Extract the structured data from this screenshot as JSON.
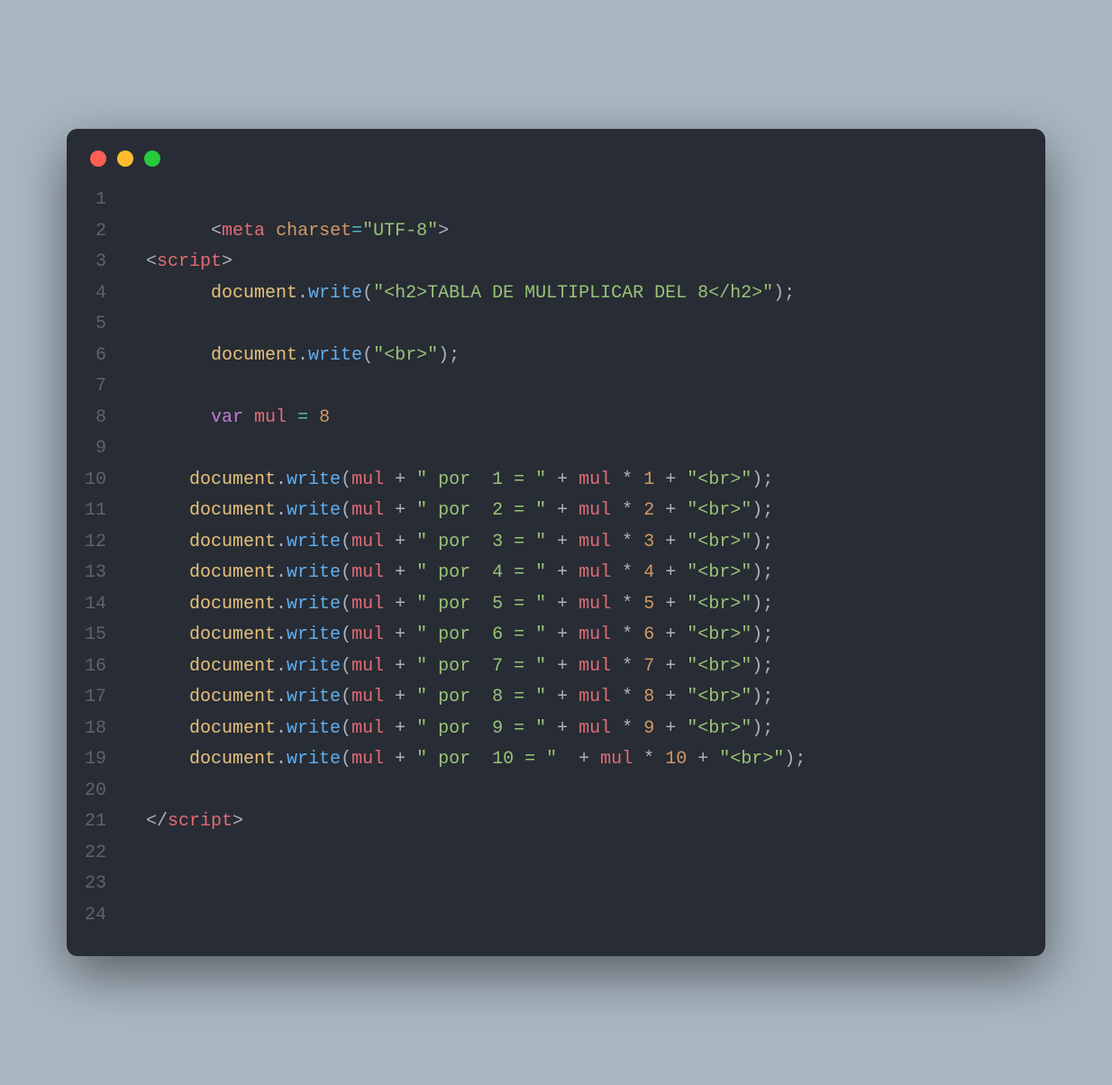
{
  "colors": {
    "background": "#abb8c3",
    "window": "#282c34",
    "red": "#ff5f56",
    "yellow": "#ffbd2e",
    "green": "#27c93f"
  },
  "lineNumbers": [
    "1",
    "2",
    "3",
    "4",
    "5",
    "6",
    "7",
    "8",
    "9",
    "10",
    "11",
    "12",
    "13",
    "14",
    "15",
    "16",
    "17",
    "18",
    "19",
    "20",
    "21",
    "22",
    "23",
    "24"
  ],
  "code": {
    "l2": {
      "indent": "        ",
      "lt": "<",
      "tag": "meta",
      "sp": " ",
      "attr": "charset",
      "eq": "=",
      "val": "\"UTF-8\"",
      "gt": ">"
    },
    "l3": {
      "indent": "  ",
      "lt": "<",
      "tag": "script",
      "gt": ">"
    },
    "l4": {
      "indent": "        ",
      "obj": "document",
      "dot": ".",
      "fn": "write",
      "lp": "(",
      "str": "\"<h2>TABLA DE MULTIPLICAR DEL 8</h2>\"",
      "rp": ")",
      "semi": ";"
    },
    "l6": {
      "indent": "        ",
      "obj": "document",
      "dot": ".",
      "fn": "write",
      "lp": "(",
      "str": "\"<br>\"",
      "rp": ")",
      "semi": ";"
    },
    "l8": {
      "indent": "        ",
      "kw": "var",
      "sp": " ",
      "name": "mul",
      "sp2": " ",
      "eq": "=",
      "sp3": " ",
      "num": "8"
    },
    "rows": [
      {
        "ln": "10",
        "str1": "\" por  1 = \"",
        "n": "1",
        "last": false
      },
      {
        "ln": "11",
        "str1": "\" por  2 = \"",
        "n": "2",
        "last": false
      },
      {
        "ln": "12",
        "str1": "\" por  3 = \"",
        "n": "3",
        "last": false
      },
      {
        "ln": "13",
        "str1": "\" por  4 = \"",
        "n": "4",
        "last": false
      },
      {
        "ln": "14",
        "str1": "\" por  5 = \"",
        "n": "5",
        "last": false
      },
      {
        "ln": "15",
        "str1": "\" por  6 = \"",
        "n": "6",
        "last": false
      },
      {
        "ln": "16",
        "str1": "\" por  7 = \"",
        "n": "7",
        "last": false
      },
      {
        "ln": "17",
        "str1": "\" por  8 = \"",
        "n": "8",
        "last": false
      },
      {
        "ln": "18",
        "str1": "\" por  9 = \"",
        "n": "9",
        "last": false
      },
      {
        "ln": "19",
        "str1": "\" por  10 = \"",
        "n": "10",
        "last": true
      }
    ],
    "rowCommon": {
      "indent": "      ",
      "obj": "document",
      "dot": ".",
      "fn": "write",
      "lp": "(",
      "mul": "mul",
      "plus": " + ",
      "star": " * ",
      "br": "\"<br>\"",
      "rp": ")",
      "semi": ";"
    },
    "l21": {
      "indent": "  ",
      "lt": "</",
      "tag": "script",
      "gt": ">"
    }
  }
}
